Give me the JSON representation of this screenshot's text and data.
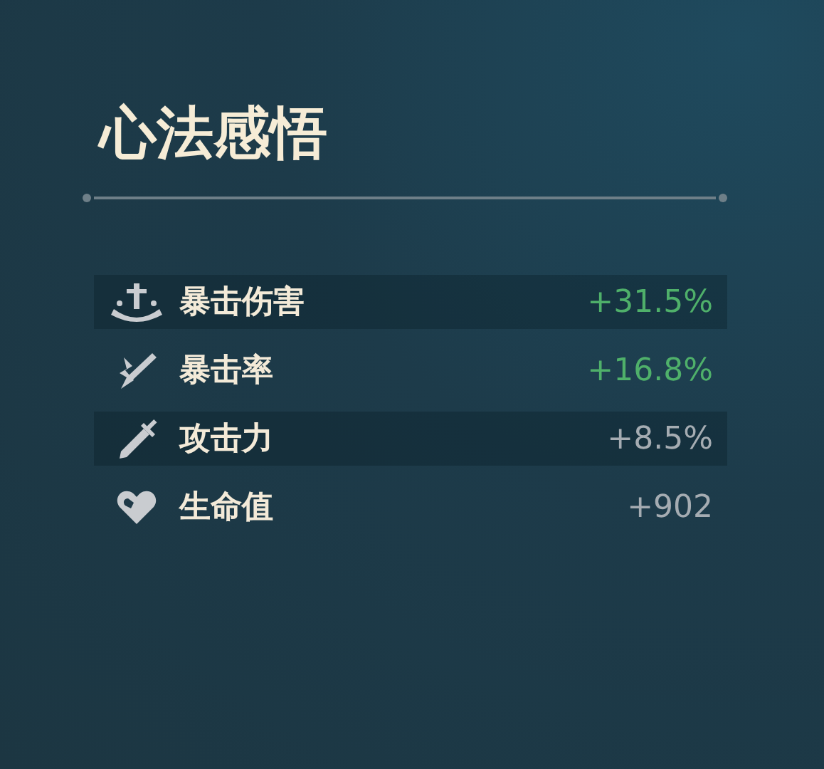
{
  "title": "心法感悟",
  "stats": [
    {
      "kind": "anchor",
      "label": "暴击伤害",
      "value": "+31.5%",
      "highlighted": true
    },
    {
      "kind": "bolt",
      "label": "暴击率",
      "value": "+16.8%",
      "highlighted": true
    },
    {
      "kind": "sword",
      "label": "攻击力",
      "value": "+8.5%",
      "highlighted": false
    },
    {
      "kind": "heart",
      "label": "生命值",
      "value": "+902",
      "highlighted": false
    }
  ]
}
